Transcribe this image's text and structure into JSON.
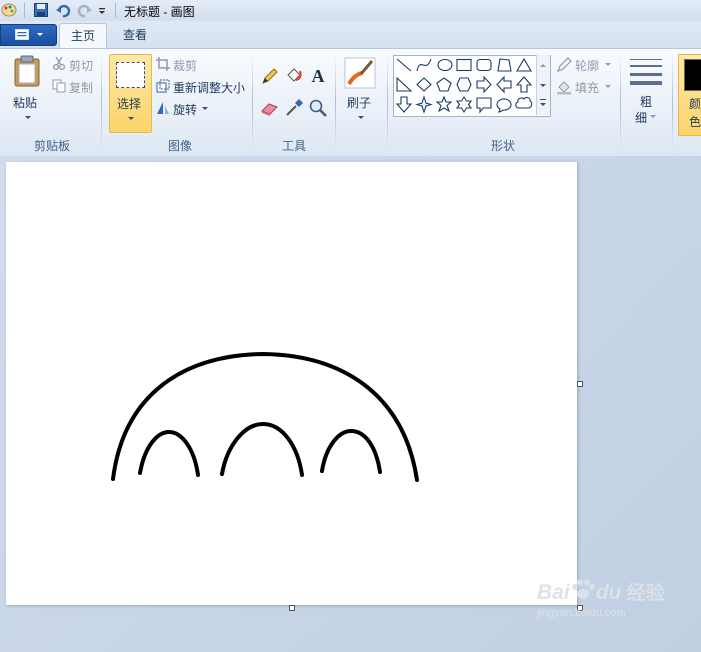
{
  "window": {
    "title": "无标题 - 画图"
  },
  "tabs": [
    {
      "label": "主页"
    },
    {
      "label": "查看"
    }
  ],
  "clipboard": {
    "paste": "粘贴",
    "cut": "剪切",
    "copy": "复制",
    "group": "剪贴板"
  },
  "image": {
    "select": "选择",
    "crop": "裁剪",
    "resize": "重新调整大小",
    "rotate": "旋转",
    "group": "图像"
  },
  "tools": {
    "group": "工具",
    "text_glyph": "A"
  },
  "brushes": {
    "label": "刷子"
  },
  "shapes": {
    "group": "形状",
    "outline": "轮廓",
    "fill": "填充"
  },
  "size": {
    "label_top": "粗",
    "label_bottom": "细"
  },
  "colors": {
    "label_top": "颜",
    "label_bottom": "色",
    "color1": "#000000"
  },
  "watermark": {
    "brand": "Bai",
    "brand2": "du",
    "product": "经验",
    "url": "jingyan.baidu.com"
  }
}
